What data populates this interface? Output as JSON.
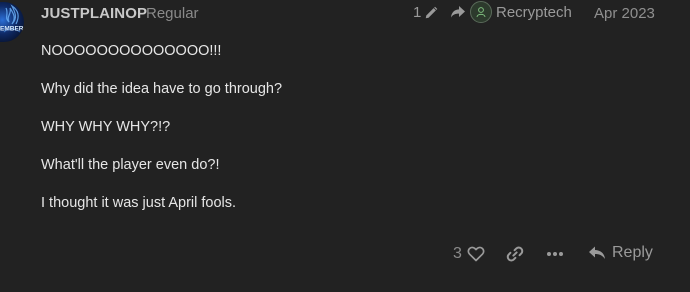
{
  "post": {
    "author": {
      "username": "JUSTPLAINOP",
      "title": "Regular",
      "avatar_text": "EMBER"
    },
    "meta": {
      "edit_count": "1",
      "reply_to_user": "Recryptech",
      "date": "Apr 2023"
    },
    "body": {
      "paragraphs": [
        "NOOOOOOOOOOOOOO!!!",
        "Why did the idea have to go through?",
        "WHY WHY WHY?!?",
        "What'll the player even do?!",
        "I thought it was just April fools."
      ]
    },
    "actions": {
      "like_count": "3",
      "reply_label": "Reply"
    }
  },
  "icons": {
    "edit": "pencil-icon",
    "reply_to": "share-arrow-icon",
    "like": "heart-icon",
    "link": "link-icon",
    "more": "ellipsis-icon",
    "reply": "reply-arrow-icon"
  },
  "colors": {
    "background": "#222222",
    "text": "#e6e6e6",
    "muted": "#8a8a8a"
  }
}
